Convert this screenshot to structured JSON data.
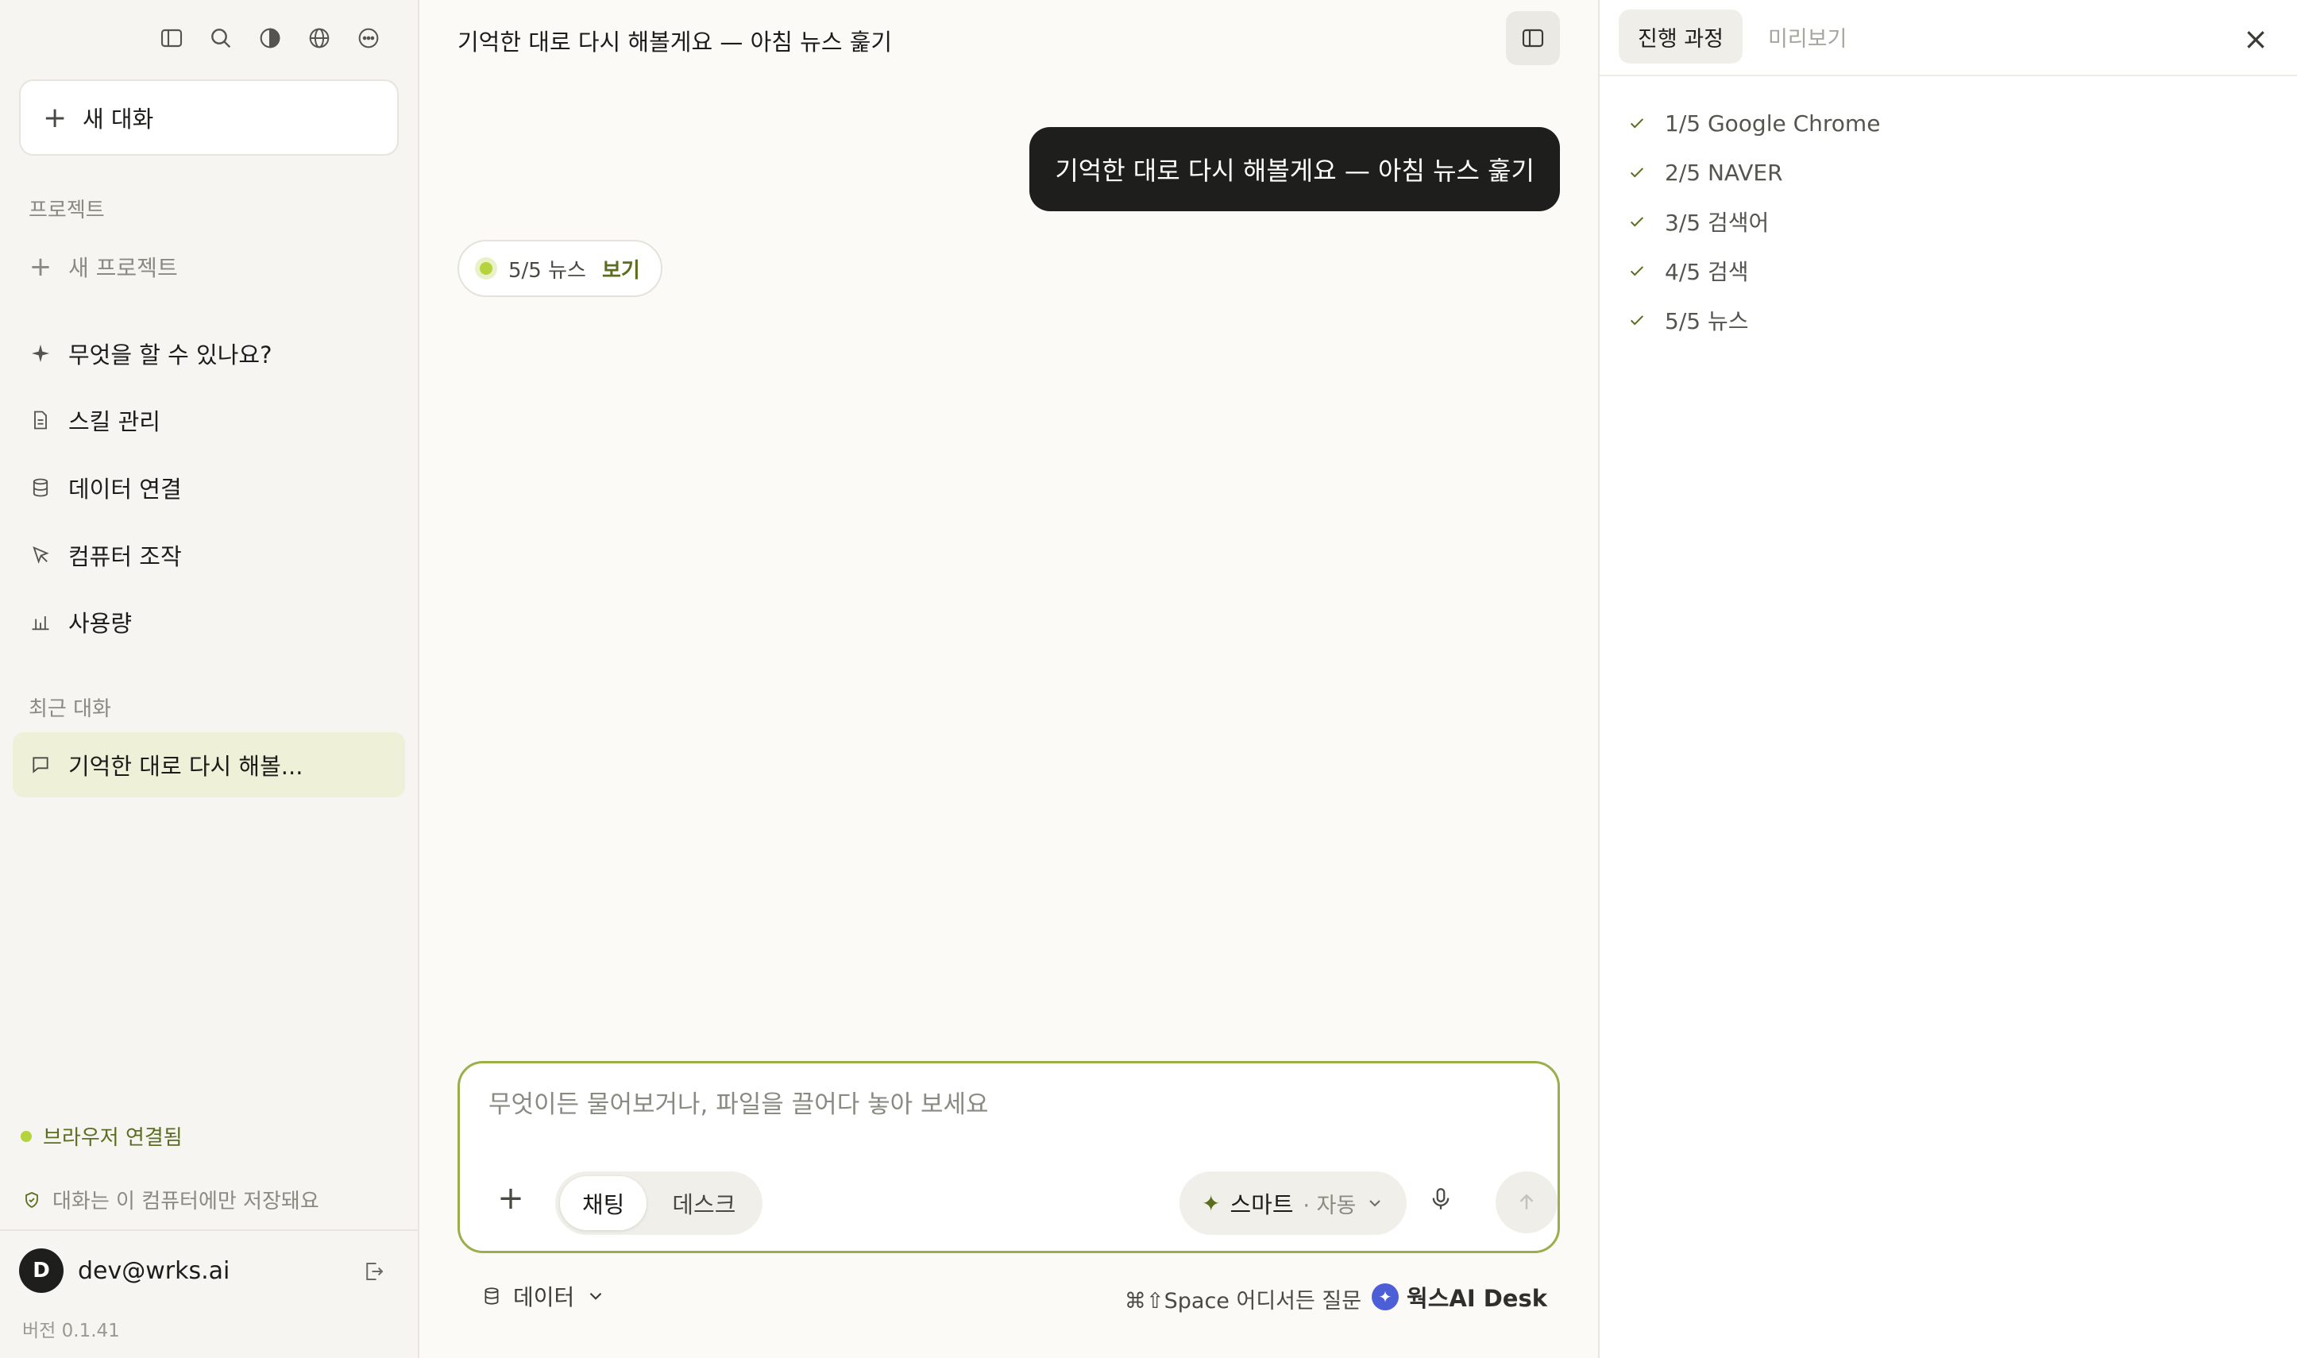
{
  "sidebar": {
    "new_chat_label": "새 대화",
    "projects_label": "프로젝트",
    "new_project_label": "새 프로젝트",
    "nav_items": [
      {
        "label": "무엇을 할 수 있나요?",
        "icon": "sparkle-icon"
      },
      {
        "label": "스킬 관리",
        "icon": "document-icon"
      },
      {
        "label": "데이터 연결",
        "icon": "database-icon"
      },
      {
        "label": "컴퓨터 조작",
        "icon": "cursor-icon"
      },
      {
        "label": "사용량",
        "icon": "bar-chart-icon"
      }
    ],
    "recent_label": "최근 대화",
    "recent_items": [
      {
        "label": "기억한 대로 다시 해볼..."
      }
    ],
    "browser_status": "브라우저 연결됨",
    "saved_note": "대화는 이 컴퓨터에만 저장돼요",
    "user": {
      "initial": "D",
      "email": "dev@wrks.ai"
    },
    "version": "버전 0.1.41"
  },
  "main": {
    "title": "기억한 대로 다시 해볼게요 — 아침 뉴스 훑기",
    "user_message": "기억한 대로 다시 해볼게요 — 아침 뉴스 훑기",
    "status_pill": {
      "text": "5/5 뉴스",
      "link": "보기"
    },
    "composer": {
      "placeholder": "무엇이든 물어보거나, 파일을 끌어다 놓아 보세요",
      "value": "",
      "modes": [
        "채팅",
        "데스크"
      ],
      "active_mode": "채팅",
      "model_label": "스마트",
      "model_sub": "· 자동"
    },
    "footer": {
      "data_label": "데이터",
      "hotkey_hint": "⌘⇧Space 어디서든 질문",
      "brand": "웍스AI Desk"
    }
  },
  "right_panel": {
    "tabs": [
      "진행 과정",
      "미리보기"
    ],
    "active_tab": "진행 과정",
    "steps": [
      "1/5 Google Chrome",
      "2/5 NAVER",
      "3/5 검색어",
      "4/5 검색",
      "5/5 뉴스"
    ]
  },
  "colors": {
    "accent": "#5b6e1f",
    "status_green": "#b5d33b",
    "recent_highlight": "#eef0d8",
    "bubble_dark": "#1e1e1c",
    "brand_blue": "#4d5fd6"
  }
}
